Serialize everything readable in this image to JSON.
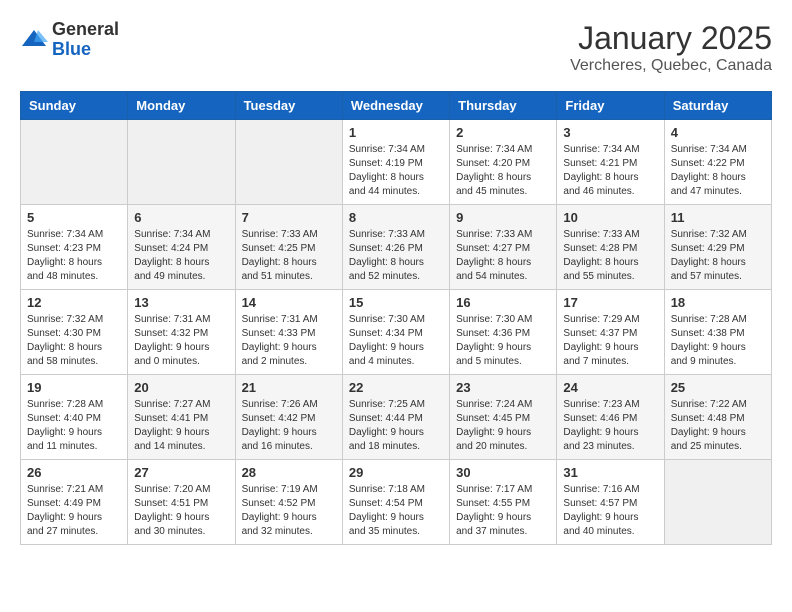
{
  "logo": {
    "general": "General",
    "blue": "Blue"
  },
  "header": {
    "month_year": "January 2025",
    "location": "Vercheres, Quebec, Canada"
  },
  "weekdays": [
    "Sunday",
    "Monday",
    "Tuesday",
    "Wednesday",
    "Thursday",
    "Friday",
    "Saturday"
  ],
  "weeks": [
    [
      {
        "num": "",
        "info": ""
      },
      {
        "num": "",
        "info": ""
      },
      {
        "num": "",
        "info": ""
      },
      {
        "num": "1",
        "info": "Sunrise: 7:34 AM\nSunset: 4:19 PM\nDaylight: 8 hours\nand 44 minutes."
      },
      {
        "num": "2",
        "info": "Sunrise: 7:34 AM\nSunset: 4:20 PM\nDaylight: 8 hours\nand 45 minutes."
      },
      {
        "num": "3",
        "info": "Sunrise: 7:34 AM\nSunset: 4:21 PM\nDaylight: 8 hours\nand 46 minutes."
      },
      {
        "num": "4",
        "info": "Sunrise: 7:34 AM\nSunset: 4:22 PM\nDaylight: 8 hours\nand 47 minutes."
      }
    ],
    [
      {
        "num": "5",
        "info": "Sunrise: 7:34 AM\nSunset: 4:23 PM\nDaylight: 8 hours\nand 48 minutes."
      },
      {
        "num": "6",
        "info": "Sunrise: 7:34 AM\nSunset: 4:24 PM\nDaylight: 8 hours\nand 49 minutes."
      },
      {
        "num": "7",
        "info": "Sunrise: 7:33 AM\nSunset: 4:25 PM\nDaylight: 8 hours\nand 51 minutes."
      },
      {
        "num": "8",
        "info": "Sunrise: 7:33 AM\nSunset: 4:26 PM\nDaylight: 8 hours\nand 52 minutes."
      },
      {
        "num": "9",
        "info": "Sunrise: 7:33 AM\nSunset: 4:27 PM\nDaylight: 8 hours\nand 54 minutes."
      },
      {
        "num": "10",
        "info": "Sunrise: 7:33 AM\nSunset: 4:28 PM\nDaylight: 8 hours\nand 55 minutes."
      },
      {
        "num": "11",
        "info": "Sunrise: 7:32 AM\nSunset: 4:29 PM\nDaylight: 8 hours\nand 57 minutes."
      }
    ],
    [
      {
        "num": "12",
        "info": "Sunrise: 7:32 AM\nSunset: 4:30 PM\nDaylight: 8 hours\nand 58 minutes."
      },
      {
        "num": "13",
        "info": "Sunrise: 7:31 AM\nSunset: 4:32 PM\nDaylight: 9 hours\nand 0 minutes."
      },
      {
        "num": "14",
        "info": "Sunrise: 7:31 AM\nSunset: 4:33 PM\nDaylight: 9 hours\nand 2 minutes."
      },
      {
        "num": "15",
        "info": "Sunrise: 7:30 AM\nSunset: 4:34 PM\nDaylight: 9 hours\nand 4 minutes."
      },
      {
        "num": "16",
        "info": "Sunrise: 7:30 AM\nSunset: 4:36 PM\nDaylight: 9 hours\nand 5 minutes."
      },
      {
        "num": "17",
        "info": "Sunrise: 7:29 AM\nSunset: 4:37 PM\nDaylight: 9 hours\nand 7 minutes."
      },
      {
        "num": "18",
        "info": "Sunrise: 7:28 AM\nSunset: 4:38 PM\nDaylight: 9 hours\nand 9 minutes."
      }
    ],
    [
      {
        "num": "19",
        "info": "Sunrise: 7:28 AM\nSunset: 4:40 PM\nDaylight: 9 hours\nand 11 minutes."
      },
      {
        "num": "20",
        "info": "Sunrise: 7:27 AM\nSunset: 4:41 PM\nDaylight: 9 hours\nand 14 minutes."
      },
      {
        "num": "21",
        "info": "Sunrise: 7:26 AM\nSunset: 4:42 PM\nDaylight: 9 hours\nand 16 minutes."
      },
      {
        "num": "22",
        "info": "Sunrise: 7:25 AM\nSunset: 4:44 PM\nDaylight: 9 hours\nand 18 minutes."
      },
      {
        "num": "23",
        "info": "Sunrise: 7:24 AM\nSunset: 4:45 PM\nDaylight: 9 hours\nand 20 minutes."
      },
      {
        "num": "24",
        "info": "Sunrise: 7:23 AM\nSunset: 4:46 PM\nDaylight: 9 hours\nand 23 minutes."
      },
      {
        "num": "25",
        "info": "Sunrise: 7:22 AM\nSunset: 4:48 PM\nDaylight: 9 hours\nand 25 minutes."
      }
    ],
    [
      {
        "num": "26",
        "info": "Sunrise: 7:21 AM\nSunset: 4:49 PM\nDaylight: 9 hours\nand 27 minutes."
      },
      {
        "num": "27",
        "info": "Sunrise: 7:20 AM\nSunset: 4:51 PM\nDaylight: 9 hours\nand 30 minutes."
      },
      {
        "num": "28",
        "info": "Sunrise: 7:19 AM\nSunset: 4:52 PM\nDaylight: 9 hours\nand 32 minutes."
      },
      {
        "num": "29",
        "info": "Sunrise: 7:18 AM\nSunset: 4:54 PM\nDaylight: 9 hours\nand 35 minutes."
      },
      {
        "num": "30",
        "info": "Sunrise: 7:17 AM\nSunset: 4:55 PM\nDaylight: 9 hours\nand 37 minutes."
      },
      {
        "num": "31",
        "info": "Sunrise: 7:16 AM\nSunset: 4:57 PM\nDaylight: 9 hours\nand 40 minutes."
      },
      {
        "num": "",
        "info": ""
      }
    ]
  ]
}
